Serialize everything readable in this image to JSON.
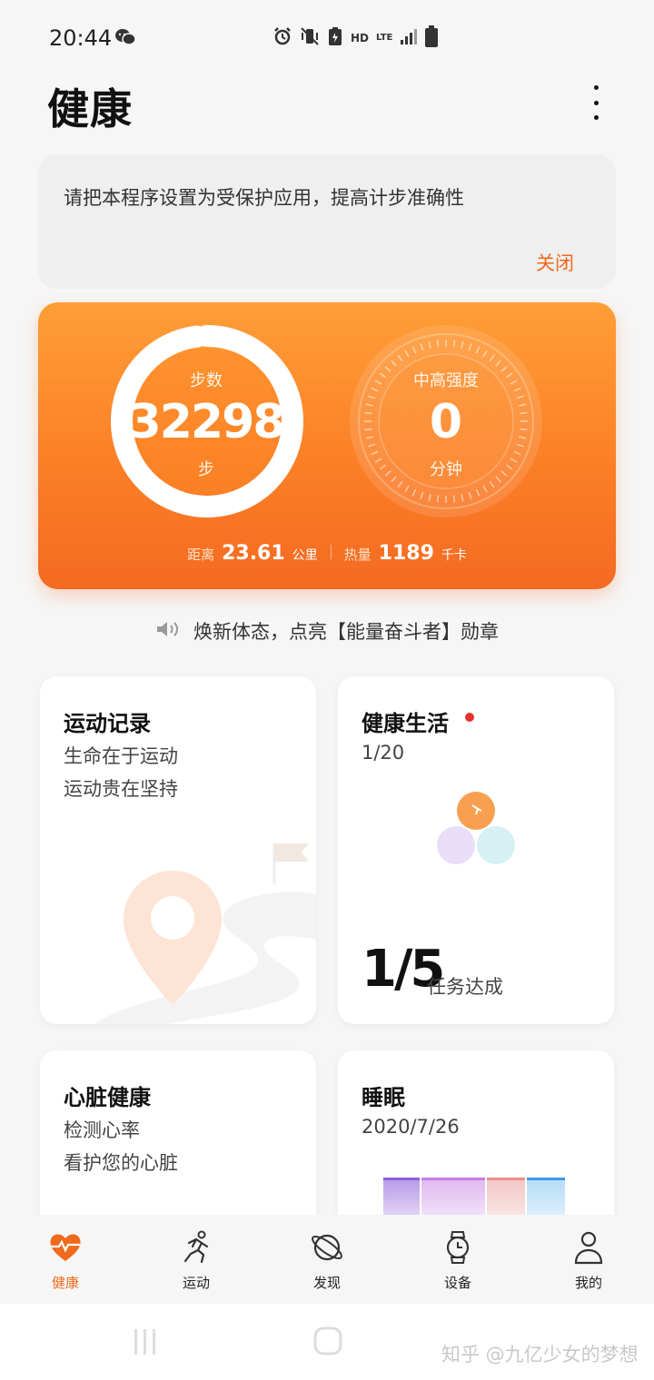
{
  "status_bar": {
    "time": "20:44",
    "icons": [
      "wechat-icon",
      "alarm-icon",
      "vibrate-icon",
      "battery-saver-icon",
      "hd-icon",
      "lte-icon",
      "signal-icon",
      "battery-icon"
    ],
    "hd_label": "HD",
    "lte_label": "LTE"
  },
  "header": {
    "title": "健康"
  },
  "notice": {
    "text": "请把本程序设置为受保护应用，提高计步准确性",
    "close_label": "关闭"
  },
  "summary": {
    "steps_label": "步数",
    "steps_value": "32298",
    "steps_unit": "步",
    "steps_goal_fraction": 0.98,
    "intensity_label": "中高强度",
    "intensity_value": "0",
    "intensity_unit": "分钟",
    "distance_label": "距离",
    "distance_value": "23.61",
    "distance_unit": "公里",
    "calories_label": "热量",
    "calories_value": "1189",
    "calories_unit": "千卡"
  },
  "announcement": {
    "text": "焕新体态，点亮【能量奋斗者】勋章"
  },
  "cards": {
    "exercise": {
      "title": "运动记录",
      "line1": "生命在于运动",
      "line2": "运动贵在坚持"
    },
    "healthy_life": {
      "title": "健康生活",
      "progress": "1/20",
      "tasks_value": "1/5",
      "tasks_label": "任务达成"
    },
    "heart": {
      "title": "心脏健康",
      "line1": "检测心率",
      "line2": "看护您的心脏"
    },
    "sleep": {
      "title": "睡眠",
      "date": "2020/7/26"
    }
  },
  "tabs": [
    {
      "label": "健康",
      "icon": "heart-pulse-icon",
      "active": true
    },
    {
      "label": "运动",
      "icon": "running-icon",
      "active": false
    },
    {
      "label": "发现",
      "icon": "planet-icon",
      "active": false
    },
    {
      "label": "设备",
      "icon": "watch-icon",
      "active": false
    },
    {
      "label": "我的",
      "icon": "person-icon",
      "active": false
    }
  ],
  "watermark": "知乎 @九亿少女的梦想",
  "colors": {
    "accent": "#f06a1e",
    "hero_top": "#ff9e36",
    "hero_bottom": "#f46a22"
  }
}
